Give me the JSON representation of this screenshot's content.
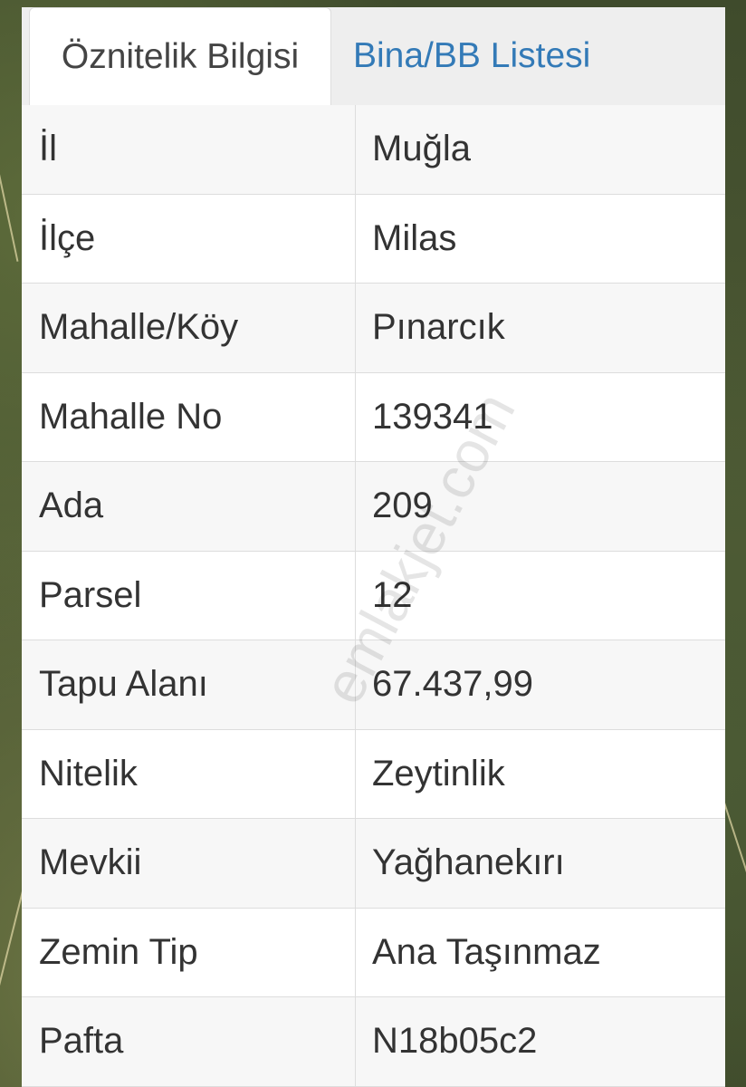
{
  "tabs": [
    {
      "label": "Öznitelik Bilgisi",
      "active": true
    },
    {
      "label": "Bina/BB Listesi",
      "active": false
    }
  ],
  "rows": [
    {
      "key": "İl",
      "value": "Muğla"
    },
    {
      "key": "İlçe",
      "value": "Milas"
    },
    {
      "key": "Mahalle/Köy",
      "value": "Pınarcık"
    },
    {
      "key": "Mahalle No",
      "value": "139341"
    },
    {
      "key": "Ada",
      "value": "209"
    },
    {
      "key": "Parsel",
      "value": "12"
    },
    {
      "key": "Tapu Alanı",
      "value": "67.437,99"
    },
    {
      "key": "Nitelik",
      "value": "Zeytinlik"
    },
    {
      "key": "Mevkii",
      "value": "Yağhanekırı"
    },
    {
      "key": "Zemin Tip",
      "value": "Ana Taşınmaz"
    },
    {
      "key": "Pafta",
      "value": "N18b05c2"
    }
  ],
  "watermark": "emlakjet.com",
  "colors": {
    "tab_link": "#337ab7",
    "text": "#333333",
    "row_stripe": "#f7f7f7",
    "border": "#dddddd"
  }
}
